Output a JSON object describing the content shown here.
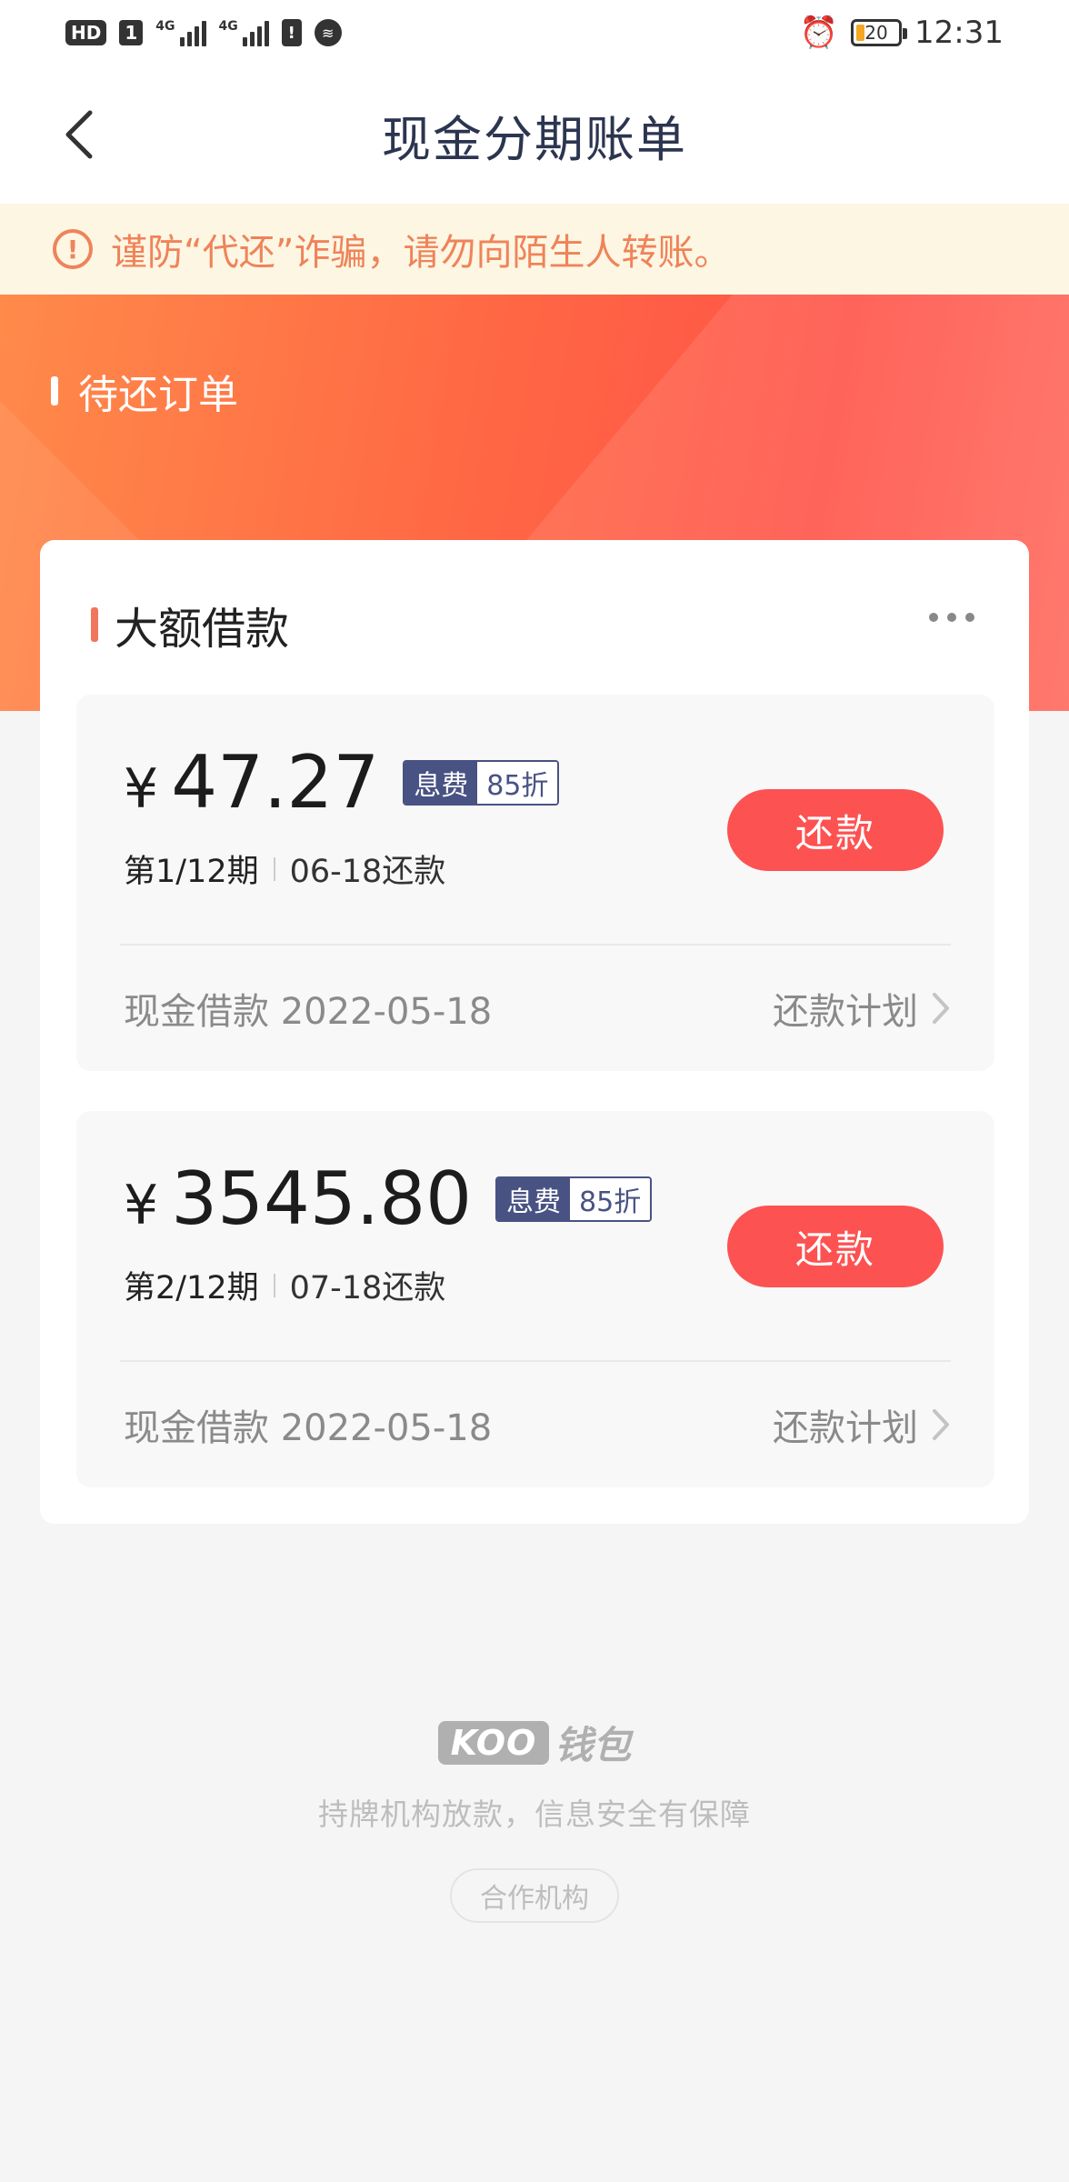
{
  "status_bar": {
    "hd": "HD",
    "sim": "1",
    "net1": "4G",
    "net2": "4G",
    "battery": "20",
    "time": "12:31"
  },
  "nav": {
    "title": "现金分期账单"
  },
  "warning": {
    "text": "谨防“代还”诈骗，请勿向陌生人转账。"
  },
  "header": {
    "section_title": "待还订单"
  },
  "card": {
    "title": "大额借款",
    "bills": [
      {
        "currency": "¥",
        "amount": "47.27",
        "tag_label": "息费",
        "tag_discount": "85折",
        "period": "第1/12期",
        "due": "06-18还款",
        "pay_label": "还款",
        "loan_info": "现金借款 2022-05-18",
        "plan_label": "还款计划"
      },
      {
        "currency": "¥",
        "amount": "3545.80",
        "tag_label": "息费",
        "tag_discount": "85折",
        "period": "第2/12期",
        "due": "07-18还款",
        "pay_label": "还款",
        "loan_info": "现金借款 2022-05-18",
        "plan_label": "还款计划"
      }
    ]
  },
  "brand": {
    "logo_koo": "KOO",
    "logo_wallet": "钱包",
    "subtitle": "持牌机构放款，信息安全有保障",
    "partner_label": "合作机构"
  },
  "colors": {
    "accent": "#fd5252",
    "tag": "#485283",
    "warning_text": "#ef8359"
  }
}
